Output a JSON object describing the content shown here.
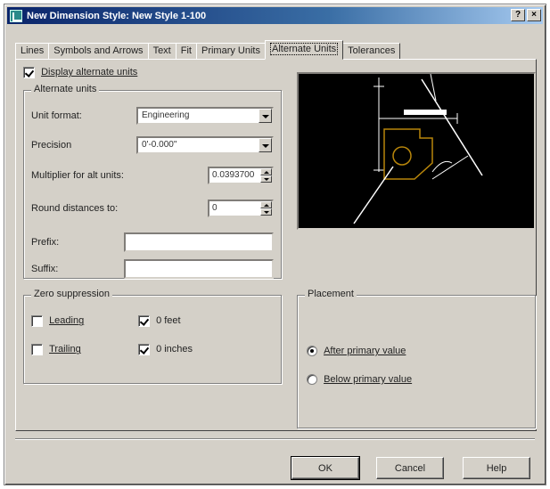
{
  "window": {
    "title": "New Dimension Style: New Style 1-100",
    "help_button": "?",
    "close_button": "×"
  },
  "tabs": [
    {
      "label": "Lines",
      "active": false
    },
    {
      "label": "Symbols and Arrows",
      "active": false
    },
    {
      "label": "Text",
      "active": false
    },
    {
      "label": "Fit",
      "active": false
    },
    {
      "label": "Primary Units",
      "active": false
    },
    {
      "label": "Alternate Units",
      "active": true
    },
    {
      "label": "Tolerances",
      "active": false
    }
  ],
  "display_alternate_units": {
    "label": "Display alternate units",
    "checked": true
  },
  "alternate_units": {
    "title": "Alternate units",
    "unit_format_label": "Unit format:",
    "unit_format_value": "Engineering",
    "precision_label": "Precision",
    "precision_value": "0'-0.000\"",
    "multiplier_label": "Multiplier for alt units:",
    "multiplier_value": "0.0393700",
    "round_label": "Round distances to:",
    "round_value": "0",
    "prefix_label": "Prefix:",
    "prefix_value": "",
    "suffix_label": "Suffix:",
    "suffix_value": ""
  },
  "zero_suppression": {
    "title": "Zero suppression",
    "leading": {
      "label": "Leading",
      "checked": false
    },
    "trailing": {
      "label": "Trailing",
      "checked": false
    },
    "feet": {
      "label": "0 feet",
      "checked": true
    },
    "inches": {
      "label": "0 inches",
      "checked": true
    }
  },
  "placement": {
    "title": "Placement",
    "after": {
      "label": "After primary value",
      "checked": true
    },
    "below": {
      "label": "Below primary value",
      "checked": false
    }
  },
  "buttons": {
    "ok": "OK",
    "cancel": "Cancel",
    "help": "Help"
  },
  "colors": {
    "dialog_bg": "#d4d0c8",
    "titlebar_start": "#0a246a",
    "preview_bg": "#000000",
    "preview_lines": "#ffffff",
    "preview_object": "#b8860b"
  }
}
